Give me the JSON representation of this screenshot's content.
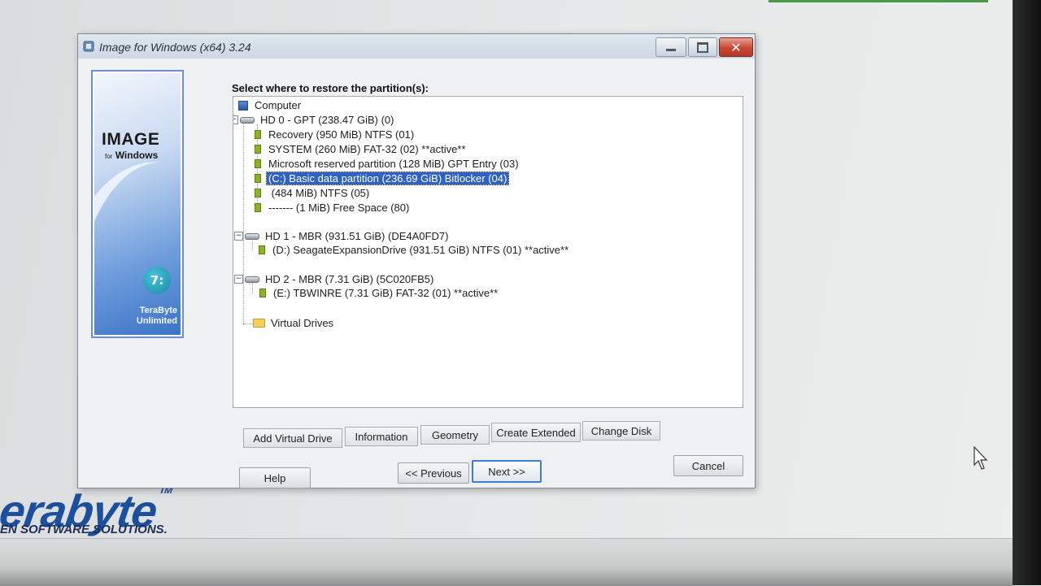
{
  "window": {
    "title": "Image for Windows (x64) 3.24",
    "close_glyph": "✕"
  },
  "banner": {
    "product": "IMAGE",
    "product_sub_for": "for",
    "product_sub": "Windows",
    "logo_glyph": "7:",
    "company_line1": "TeraByte",
    "company_line2": "Unlimited"
  },
  "prompt": "Select where to restore the partition(s):",
  "tree": {
    "computer": "Computer",
    "disks": [
      {
        "label": "HD 0 - GPT (238.47 GiB) (0)",
        "partitions": [
          "Recovery (950 MiB) NTFS (01)",
          "SYSTEM (260 MiB) FAT-32 (02) **active**",
          "Microsoft reserved partition (128 MiB) GPT Entry (03)",
          "(C:) Basic data partition (236.69 GiB) Bitlocker (04)",
          " (484 MiB) NTFS (05)",
          "------- (1 MiB) Free Space (80)"
        ],
        "selected_index": 3
      },
      {
        "label": "HD 1 - MBR (931.51 GiB) (DE4A0FD7)",
        "partitions": [
          "(D:) SeagateExpansionDrive (931.51 GiB) NTFS (01) **active**"
        ]
      },
      {
        "label": "HD 2 - MBR (7.31 GiB) (5C020FB5)",
        "partitions": [
          "(E:) TBWINRE (7.31 GiB) FAT-32 (01) **active**"
        ]
      }
    ],
    "virtual_drives": "Virtual Drives",
    "expander_glyph": "−"
  },
  "toolbar": {
    "add_virtual_drive": "Add Virtual Drive",
    "information": "Information",
    "geometry": "Geometry",
    "create_extended": "Create Extended",
    "change_disk": "Change Disk"
  },
  "buttons": {
    "help": "Help",
    "previous": "<< Previous",
    "next": "Next >>",
    "cancel": "Cancel"
  },
  "background": {
    "brand_logo": "erabyte",
    "brand_tm": "TM",
    "tagline": "EN SOFTWARE SOLUTIONS."
  },
  "colors": {
    "selection": "#2e62c5",
    "partition_icon": "#8ab422",
    "brand_blue": "#1c4f9c"
  }
}
